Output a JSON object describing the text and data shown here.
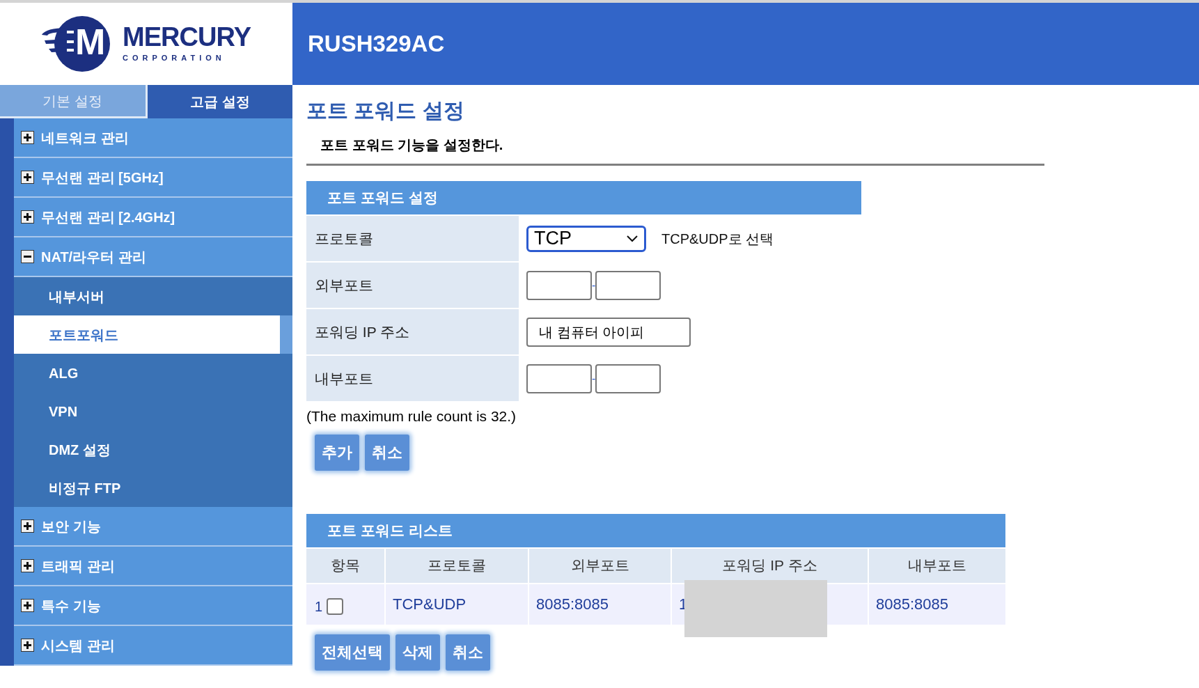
{
  "logo": {
    "letter": "M",
    "name": "MERCURY",
    "tagline": "CORPORATION"
  },
  "header": {
    "title": "RUSH329AC"
  },
  "tabs": [
    {
      "label": "기본 설정",
      "selected": false
    },
    {
      "label": "고급 설정",
      "selected": true
    }
  ],
  "sidebar": {
    "items": [
      {
        "label": "네트워크 관리",
        "expanded": false
      },
      {
        "label": "무선랜 관리 [5GHz]",
        "expanded": false
      },
      {
        "label": "무선랜 관리 [2.4GHz]",
        "expanded": false
      },
      {
        "label": "NAT/라우터 관리",
        "expanded": true,
        "children": [
          {
            "label": "내부서버",
            "selected": false
          },
          {
            "label": "포트포워드",
            "selected": true
          },
          {
            "label": "ALG",
            "selected": false
          },
          {
            "label": "VPN",
            "selected": false
          },
          {
            "label": "DMZ 설정",
            "selected": false
          },
          {
            "label": "비정규 FTP",
            "selected": false
          }
        ]
      },
      {
        "label": "보안 기능",
        "expanded": false
      },
      {
        "label": "트래픽 관리",
        "expanded": false
      },
      {
        "label": "특수 기능",
        "expanded": false
      },
      {
        "label": "시스템 관리",
        "expanded": false
      }
    ]
  },
  "page": {
    "title": "포트 포워드 설정",
    "description": "포트 포워드 기능을 설정한다."
  },
  "form": {
    "title": "포트 포워드 설정",
    "rows": [
      {
        "label": "프로토콜",
        "kind": "select",
        "value": "TCP",
        "hint": "TCP&UDP로 선택"
      },
      {
        "label": "외부포트",
        "kind": "range",
        "separator": "-"
      },
      {
        "label": "포워딩 IP 주소",
        "kind": "text",
        "value": "내 컴퓨터 아이피"
      },
      {
        "label": "내부포트",
        "kind": "range",
        "separator": "-"
      }
    ],
    "note": "(The maximum rule count is 32.)",
    "buttons": [
      "추가",
      "취소"
    ]
  },
  "list": {
    "title": "포트 포워드 리스트",
    "columns": [
      "항목",
      "프로토콜",
      "외부포트",
      "포워딩 IP 주소",
      "내부포트"
    ],
    "rows": [
      {
        "index": "1",
        "checked": false,
        "protocol": "TCP&UDP",
        "external_port": "8085:8085",
        "ip": "1",
        "ip_redacted": true,
        "internal_port": "8085:8085"
      }
    ],
    "buttons": [
      "전체선택",
      "삭제",
      "취소"
    ]
  }
}
